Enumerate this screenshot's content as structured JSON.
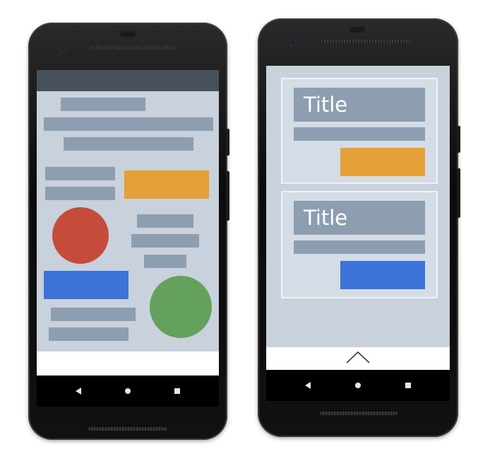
{
  "colors": {
    "screen_bg": "#c8d1dc",
    "status_bar": "#46515b",
    "placeholder_bar": "#8d9eb0",
    "orange": "#e5a037",
    "red": "#c54c3a",
    "blue": "#3c73d9",
    "green": "#64a15d",
    "card_bg": "#d4dce5"
  },
  "left_phone": {
    "shapes": [
      "orange-rectangle",
      "red-circle",
      "blue-rectangle",
      "green-circle"
    ]
  },
  "right_phone": {
    "cards": [
      {
        "title": "Title",
        "button_color": "#e5a037"
      },
      {
        "title": "Title",
        "button_color": "#3c73d9"
      }
    ],
    "bottom_icon": "chevron-up-icon"
  },
  "nav_icons": [
    "back-icon",
    "home-icon",
    "recents-icon"
  ]
}
